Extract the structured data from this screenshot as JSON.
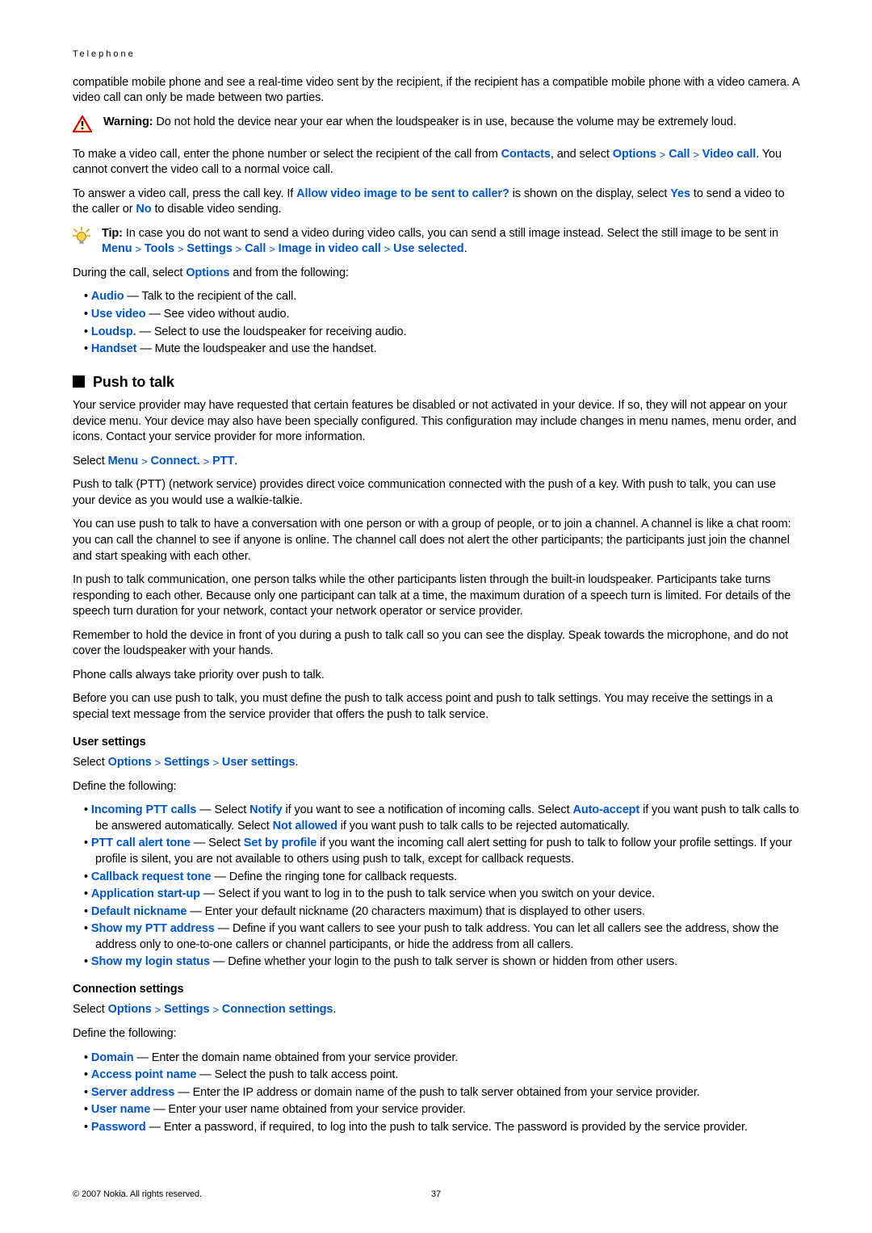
{
  "header": "Telephone",
  "intro": {
    "p1a": "compatible mobile phone and see a real-time video sent by the recipient, if the recipient has a compatible mobile phone with a video camera. A video call can only be made between two parties.",
    "warn_label": "Warning:  ",
    "warn_text": "Do not hold the device near your ear when the loudspeaker is in use, because the volume may be extremely loud.",
    "p2_pre": "To make a video call, enter the phone number or select the recipient of the call from ",
    "p2_contacts": "Contacts",
    "p2_mid": ", and select ",
    "p2_options": "Options",
    "p2_call": "Call",
    "p2_videocall": "Video call",
    "p2_post": ". You cannot convert the video call to a normal voice call.",
    "p3_pre": "To answer a video call, press the call key. If ",
    "p3_allow": "Allow video image to be sent to caller?",
    "p3_mid": " is shown on the display, select ",
    "p3_yes": "Yes",
    "p3_mid2": " to send a video to the caller or ",
    "p3_no": "No",
    "p3_post": " to disable video sending.",
    "tip_label": "Tip: ",
    "tip_text": "In case you do not want to send a video during video calls, you can send a still image instead. Select the still image to be sent in ",
    "tip_path": [
      "Menu",
      "Tools",
      "Settings",
      "Call",
      "Image in video call",
      "Use selected"
    ],
    "p4_pre": "During the call, select ",
    "p4_options": "Options",
    "p4_post": " and from the following:",
    "opts": [
      {
        "t": "Audio",
        "d": " — Talk to the recipient of the call."
      },
      {
        "t": "Use video",
        "d": " — See video without audio."
      },
      {
        "t": "Loudsp.",
        "d": " — Select to use the loudspeaker for receiving audio."
      },
      {
        "t": "Handset",
        "d": " — Mute the loudspeaker and use the handset."
      }
    ]
  },
  "ptt": {
    "title": "Push to talk",
    "p1": "Your service provider may have requested that certain features be disabled or not activated in your device. If so, they will not appear on your device menu. Your device may also have been specially configured. This configuration may include changes in menu names, menu order, and icons. Contact your service provider for more information.",
    "sel_pre": "Select ",
    "sel_path": [
      "Menu",
      "Connect.",
      "PTT"
    ],
    "p2": "Push to talk (PTT) (network service) provides direct voice communication connected with the push of a key. With push to talk, you can use your device as you would use a walkie-talkie.",
    "p3": "You can use push to talk to have a conversation with one person or with a group of people, or to join a channel. A channel is like a chat room: you can call the channel to see if anyone is online. The channel call does not alert the other participants; the participants just join the channel and start speaking with each other.",
    "p4": "In push to talk communication, one person talks while the other participants listen through the built-in loudspeaker. Participants take turns responding to each other. Because only one participant can talk at a time, the maximum duration of a speech turn is limited. For details of the speech turn duration for your network, contact your network operator or service provider.",
    "p5": "Remember to hold the device in front of you during a push to talk call so you can see the display. Speak towards the microphone, and do not cover the loudspeaker with your hands.",
    "p6": "Phone calls always take priority over push to talk.",
    "p7": "Before you can use push to talk, you must define the push to talk access point and push to talk settings. You may receive the settings in a special text message from the service provider that offers the push to talk service."
  },
  "user": {
    "title": "User settings",
    "sel_pre": "Select ",
    "sel_path": [
      "Options",
      "Settings",
      "User settings"
    ],
    "define": "Define the following:",
    "items": [
      {
        "t": "Incoming PTT calls",
        "d_pre": " — Select ",
        "i1": "Notify",
        "d_mid": " if you want to see a notification of incoming calls. Select ",
        "i2": "Auto-accept",
        "d_mid2": " if you want push to talk calls to be answered automatically. Select ",
        "i3": "Not allowed",
        "d_post": " if you want push to talk calls to be rejected automatically."
      },
      {
        "t": "PTT call alert tone",
        "d_pre": " — Select ",
        "i1": "Set by profile",
        "d_post": " if you want the incoming call alert setting for push to talk to follow your profile settings. If your profile is silent, you are not available to others using push to talk, except for callback requests."
      },
      {
        "t": "Callback request tone",
        "d_post": " — Define the ringing tone for callback requests."
      },
      {
        "t": "Application start-up",
        "d_post": " — Select if you want to log in to the push to talk service when you switch on your device."
      },
      {
        "t": "Default nickname",
        "d_post": " — Enter your default nickname (20 characters maximum) that is displayed to other users."
      },
      {
        "t": "Show my PTT address",
        "d_post": " — Define if you want callers to see your push to talk address. You can let all callers see the address, show the address only to one-to-one callers or channel participants, or hide the address from all callers."
      },
      {
        "t": "Show my login status",
        "d_post": " — Define whether your login to the push to talk server is shown or hidden from other users."
      }
    ]
  },
  "conn": {
    "title": "Connection settings",
    "sel_pre": "Select ",
    "sel_path": [
      "Options",
      "Settings",
      "Connection settings"
    ],
    "define": "Define the following:",
    "items": [
      {
        "t": "Domain",
        "d": " — Enter the domain name obtained from your service provider."
      },
      {
        "t": "Access point name",
        "d": " — Select the push to talk access point."
      },
      {
        "t": "Server address",
        "d": " — Enter the IP address or domain name of the push to talk server obtained from your service provider."
      },
      {
        "t": "User name",
        "d": " — Enter your user name obtained from your service provider."
      },
      {
        "t": "Password",
        "d": " — Enter a password, if required, to log into the push to talk service. The password is provided by the service provider."
      }
    ]
  },
  "footer": {
    "copyright": "© 2007 Nokia. All rights reserved.",
    "page": "37"
  }
}
